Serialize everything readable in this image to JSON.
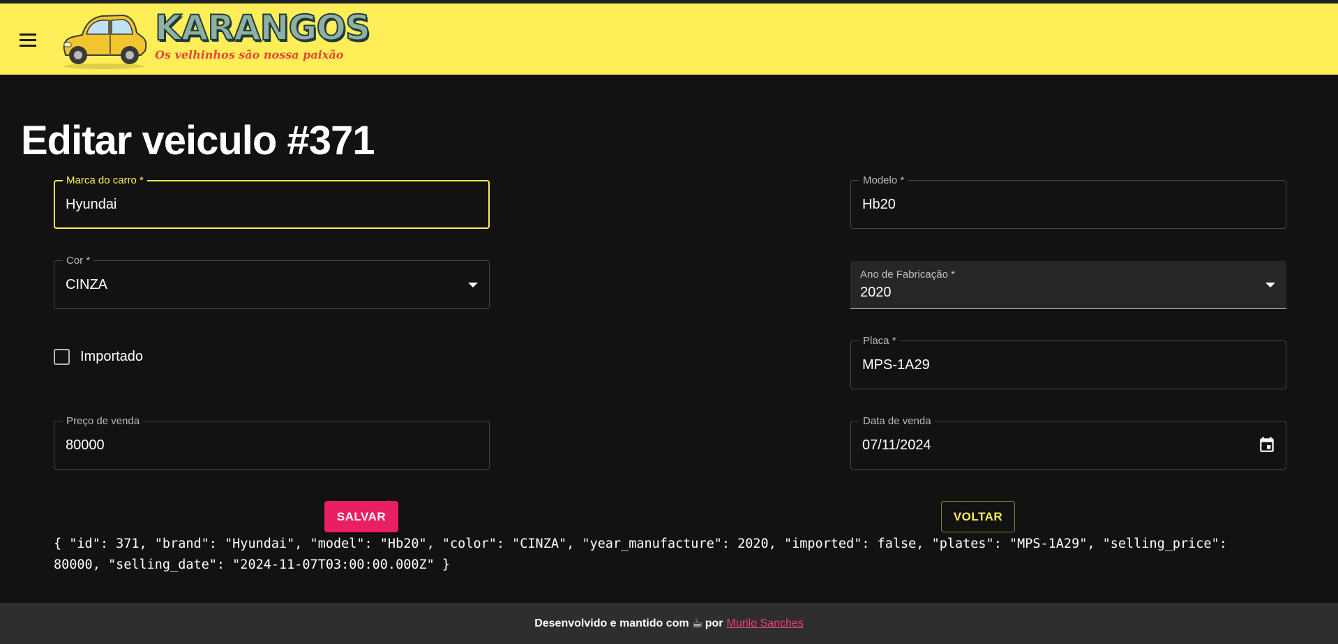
{
  "header": {
    "menu_icon": "menu-icon",
    "logo_title": "KARANGOS",
    "logo_subtitle": "Os velhinhos são nossa paixão",
    "logo_colors": {
      "car": "#f2c52e",
      "title": "#8fb0a0",
      "subtitle": "#e0483a"
    },
    "bar_color": "#ffee58"
  },
  "page": {
    "title": "Editar veiculo #371"
  },
  "form": {
    "brand": {
      "label": "Marca do carro *",
      "value": "Hyundai"
    },
    "model": {
      "label": "Modelo *",
      "value": "Hb20"
    },
    "color": {
      "label": "Cor *",
      "value": "CINZA"
    },
    "year_manufacture": {
      "label": "Ano de Fabricação *",
      "value": "2020"
    },
    "imported": {
      "label": "Importado",
      "checked": false
    },
    "plates": {
      "label": "Placa *",
      "value": "MPS-1A29"
    },
    "selling_price": {
      "label": "Preço de venda",
      "value": "80000"
    },
    "selling_date": {
      "label": "Data de venda",
      "value": "07/11/2024",
      "icon": "calendar-icon"
    }
  },
  "actions": {
    "save_label": "SALVAR",
    "back_label": "VOLTAR",
    "save_color": "#e91e63",
    "back_color": "#ffee58"
  },
  "debug_json": "{ \"id\": 371, \"brand\": \"Hyundai\", \"model\": \"Hb20\", \"color\": \"CINZA\", \"year_manufacture\": 2020, \"imported\": false, \"plates\": \"MPS-1A29\", \"selling_price\":\n80000, \"selling_date\": \"2024-11-07T03:00:00.000Z\" }",
  "footer": {
    "text_before": "Desenvolvido e mantido com",
    "icon": "coffee-icon",
    "text_by": "por",
    "author_link": "Murilo Sanches"
  }
}
